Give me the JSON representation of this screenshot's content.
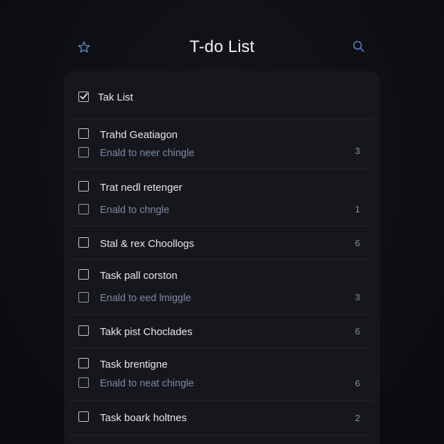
{
  "header": {
    "title": "T-do List",
    "star_icon": "star-icon",
    "search_icon": "search-icon"
  },
  "list": {
    "title": "Tak List",
    "checked": true
  },
  "tasks": [
    {
      "title": "Trahd Geatiagon",
      "subtitle": "Enald to neer chingle",
      "count": "3"
    },
    {
      "title": "Trat nedl retenger",
      "subtitle": "Enald to chngle",
      "count": "1"
    },
    {
      "title": "Stal & rex Choollogs",
      "subtitle": "",
      "count": "6"
    },
    {
      "title": "Task pall corston",
      "subtitle": "Enald to eed lmiggle",
      "count": "3"
    },
    {
      "title": "Takk pist Choclades",
      "subtitle": "",
      "count": "6"
    },
    {
      "title": "Task brentigne",
      "subtitle": "Enald to neat chingle",
      "count": "6"
    },
    {
      "title": "Task boark holtnes",
      "subtitle": "",
      "count": "2"
    }
  ],
  "colors": {
    "accent_blue": "#5b87c9",
    "background": "#0c0e12",
    "card": "#15171c"
  }
}
